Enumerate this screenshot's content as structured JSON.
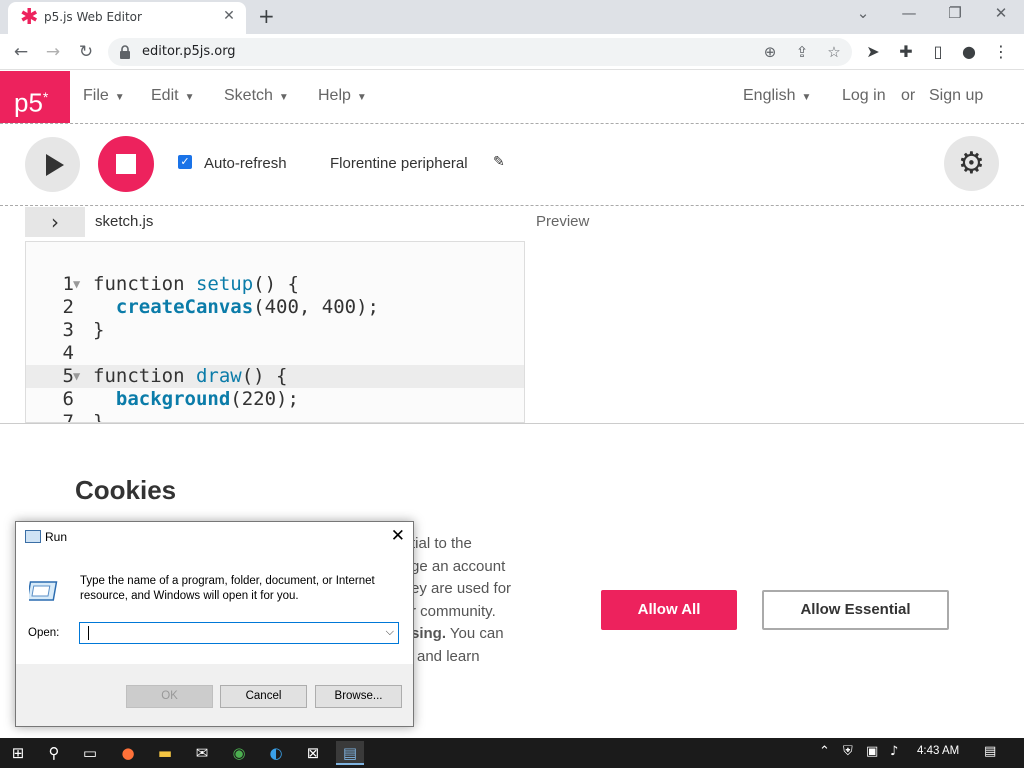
{
  "browser": {
    "tab_title": "p5.js Web Editor",
    "tab_close": "✕",
    "new_tab": "+",
    "url": "editor.p5js.org",
    "window_controls": {
      "minimize": "—",
      "restore": "❐",
      "close": "✕",
      "dropdown": "⌄"
    }
  },
  "p5": {
    "logo": "p5",
    "logo_sup": "*",
    "menu": [
      {
        "label": "File"
      },
      {
        "label": "Edit"
      },
      {
        "label": "Sketch"
      },
      {
        "label": "Help"
      }
    ],
    "language": "English",
    "login": "Log in",
    "or": "or",
    "signup": "Sign up",
    "accent_color": "#ed225d"
  },
  "toolbar": {
    "autorefresh_label": "Auto-refresh",
    "autorefresh_checked": true,
    "sketch_name": "Florentine peripheral"
  },
  "editor": {
    "file_toggle": "›",
    "file_name": "sketch.js",
    "preview_label": "Preview",
    "lines": [
      {
        "num": "1",
        "fold": "▼"
      },
      {
        "num": "2",
        "fold": ""
      },
      {
        "num": "3",
        "fold": ""
      },
      {
        "num": "4",
        "fold": ""
      },
      {
        "num": "5",
        "fold": "▼"
      },
      {
        "num": "6",
        "fold": ""
      },
      {
        "num": "7",
        "fold": ""
      }
    ],
    "code": {
      "l1_kw": "function ",
      "l1_fn": "setup",
      "l1_rest": "() {",
      "l2_indent": "  ",
      "l2_fn": "createCanvas",
      "l2_rest": "(400, 400);",
      "l3": "}",
      "l5_kw": "function ",
      "l5_fn": "draw",
      "l5_rest": "() {",
      "l6_indent": "  ",
      "l6_fn": "background",
      "l6_rest": "(220);",
      "l7": "}"
    }
  },
  "cookies": {
    "title": "Cookies",
    "text_lines": [
      "tial to the",
      "ge an account",
      "ey are used for",
      "r community."
    ],
    "text_line5_bold": "sing.",
    "text_line5_rest": " You can",
    "text_line6": "and learn",
    "allow_all": "Allow All",
    "allow_essential": "Allow Essential"
  },
  "run_dialog": {
    "title": "Run",
    "close": "✕",
    "description": "Type the name of a program, folder, document, or Internet resource, and Windows will open it for you.",
    "open_label": "Open:",
    "input_value": "",
    "ok": "OK",
    "cancel": "Cancel",
    "browse": "Browse..."
  },
  "taskbar": {
    "time": "4:43 AM"
  }
}
